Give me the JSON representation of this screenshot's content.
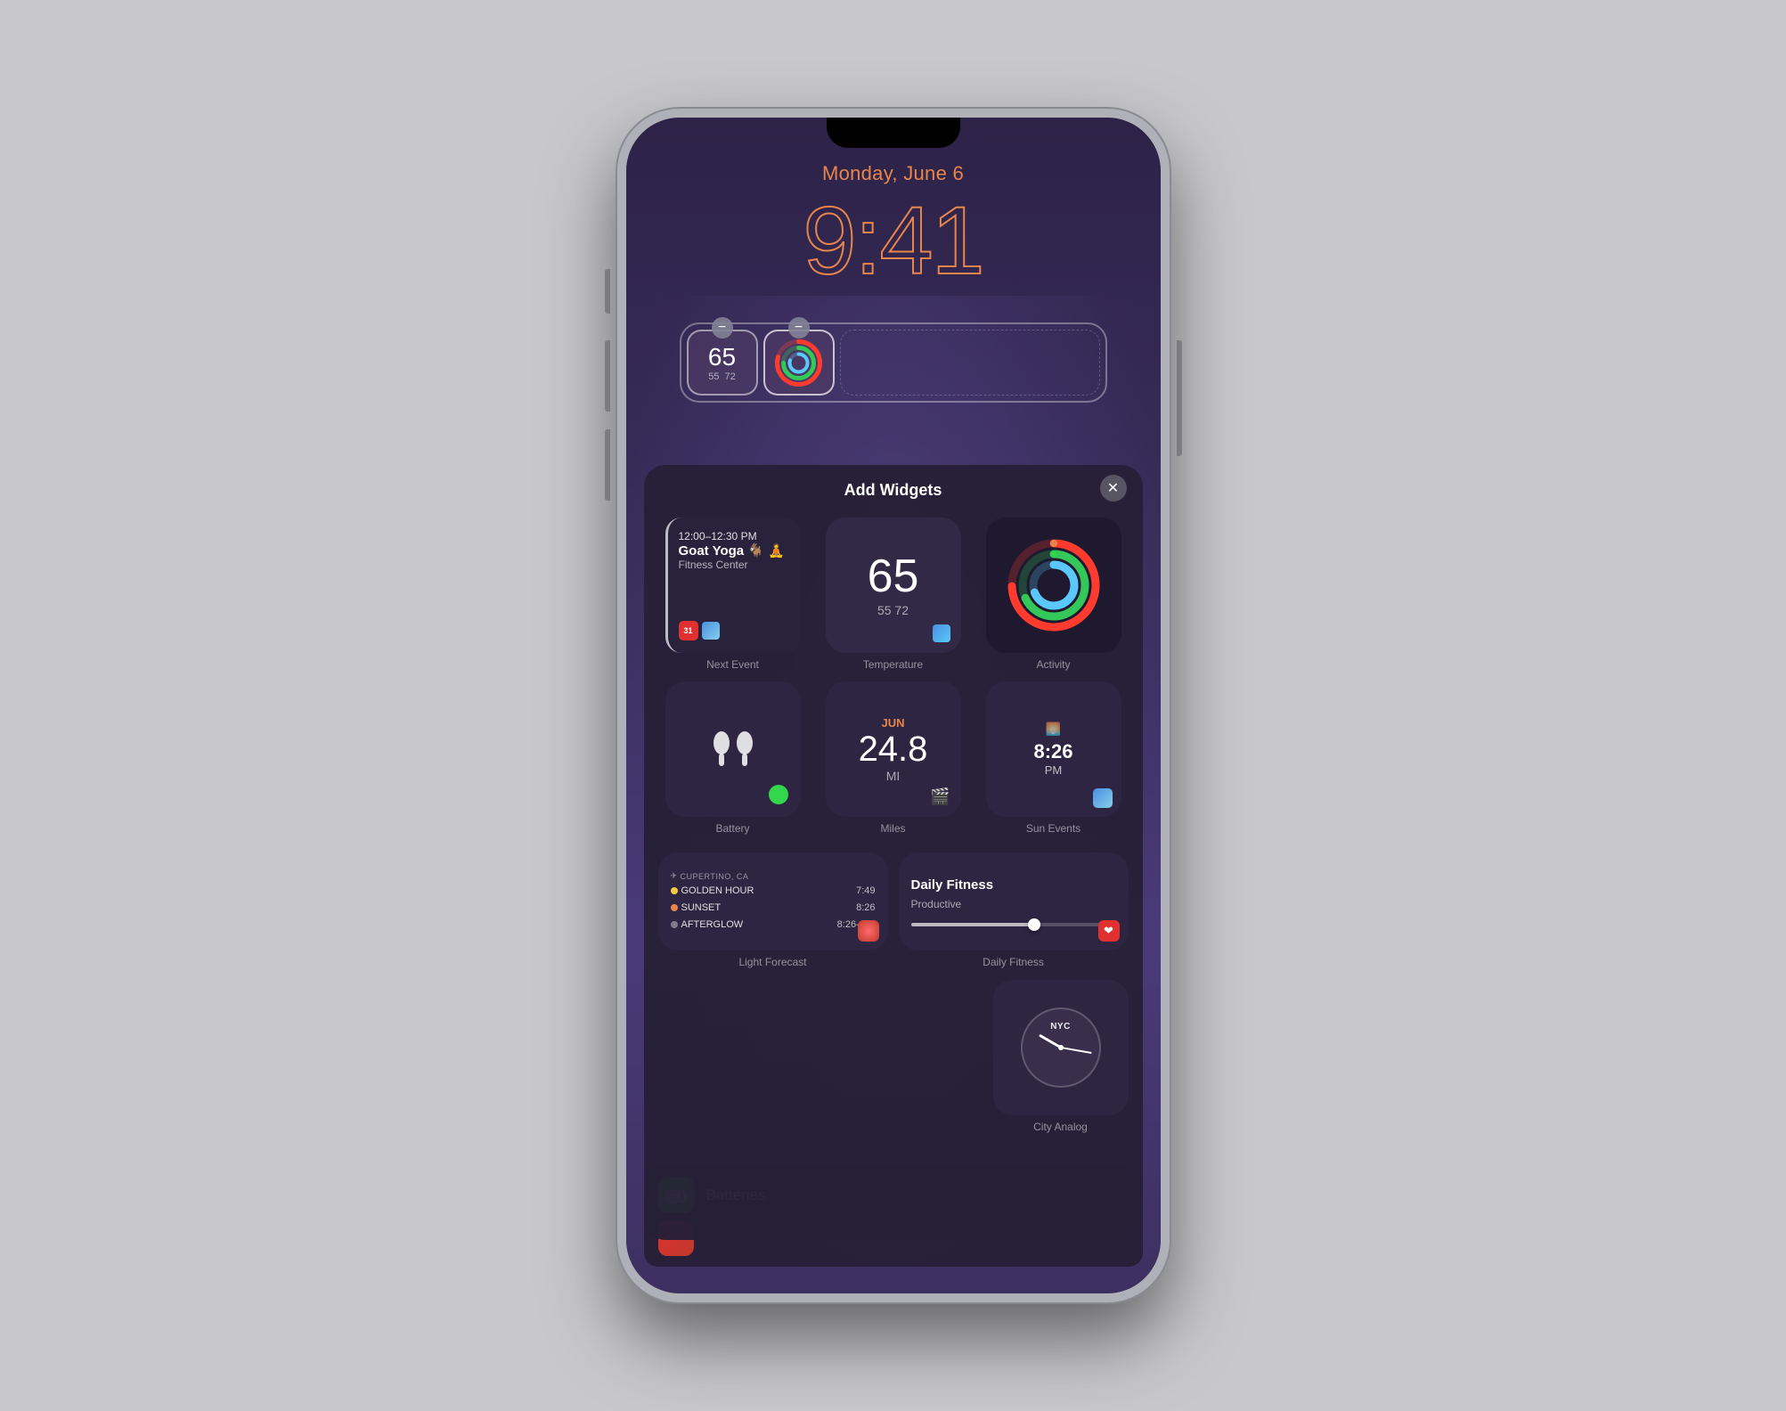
{
  "background": "#c8c8cc",
  "phone": {
    "lockscreen": {
      "date": "Monday, June 6",
      "time": "9:41",
      "widget1_temp": "65",
      "widget1_range": "55  72"
    },
    "modal": {
      "title": "Add Widgets",
      "close_label": "✕",
      "widgets": [
        {
          "id": "next-event",
          "label": "Next Event",
          "event_time": "12:00–12:30 PM",
          "event_name": "Goat Yoga",
          "event_emoji": "🐐 🧘",
          "event_location": "Fitness Center"
        },
        {
          "id": "temperature",
          "label": "Temperature",
          "temp": "65",
          "range": "55  72"
        },
        {
          "id": "activity",
          "label": "Activity"
        },
        {
          "id": "battery",
          "label": "Battery"
        },
        {
          "id": "miles",
          "label": "Miles",
          "month": "JUN",
          "value": "24.8",
          "unit": "MI"
        },
        {
          "id": "sun-events",
          "label": "Sun Events",
          "time": "8:26",
          "period": "PM"
        },
        {
          "id": "city-analog",
          "label": "City Analog",
          "city": "NYC"
        }
      ],
      "light_forecast": {
        "label": "Light Forecast",
        "location": "CUPERTINO, CA",
        "rows": [
          {
            "icon": "sun",
            "name": "GOLDEN HOUR",
            "time": "7:49"
          },
          {
            "icon": "sun2",
            "name": "SUNSET",
            "time": "8:26"
          },
          {
            "icon": "sun3",
            "name": "AFTERGLOW",
            "time": "8:26–8:5"
          }
        ]
      },
      "daily_fitness": {
        "label": "Daily Fitness",
        "title": "Daily Fitness",
        "subtitle": "Productive",
        "slider_percent": 60
      }
    },
    "batteries_section": {
      "app1_name": "Batteries",
      "app2_name": ""
    }
  }
}
